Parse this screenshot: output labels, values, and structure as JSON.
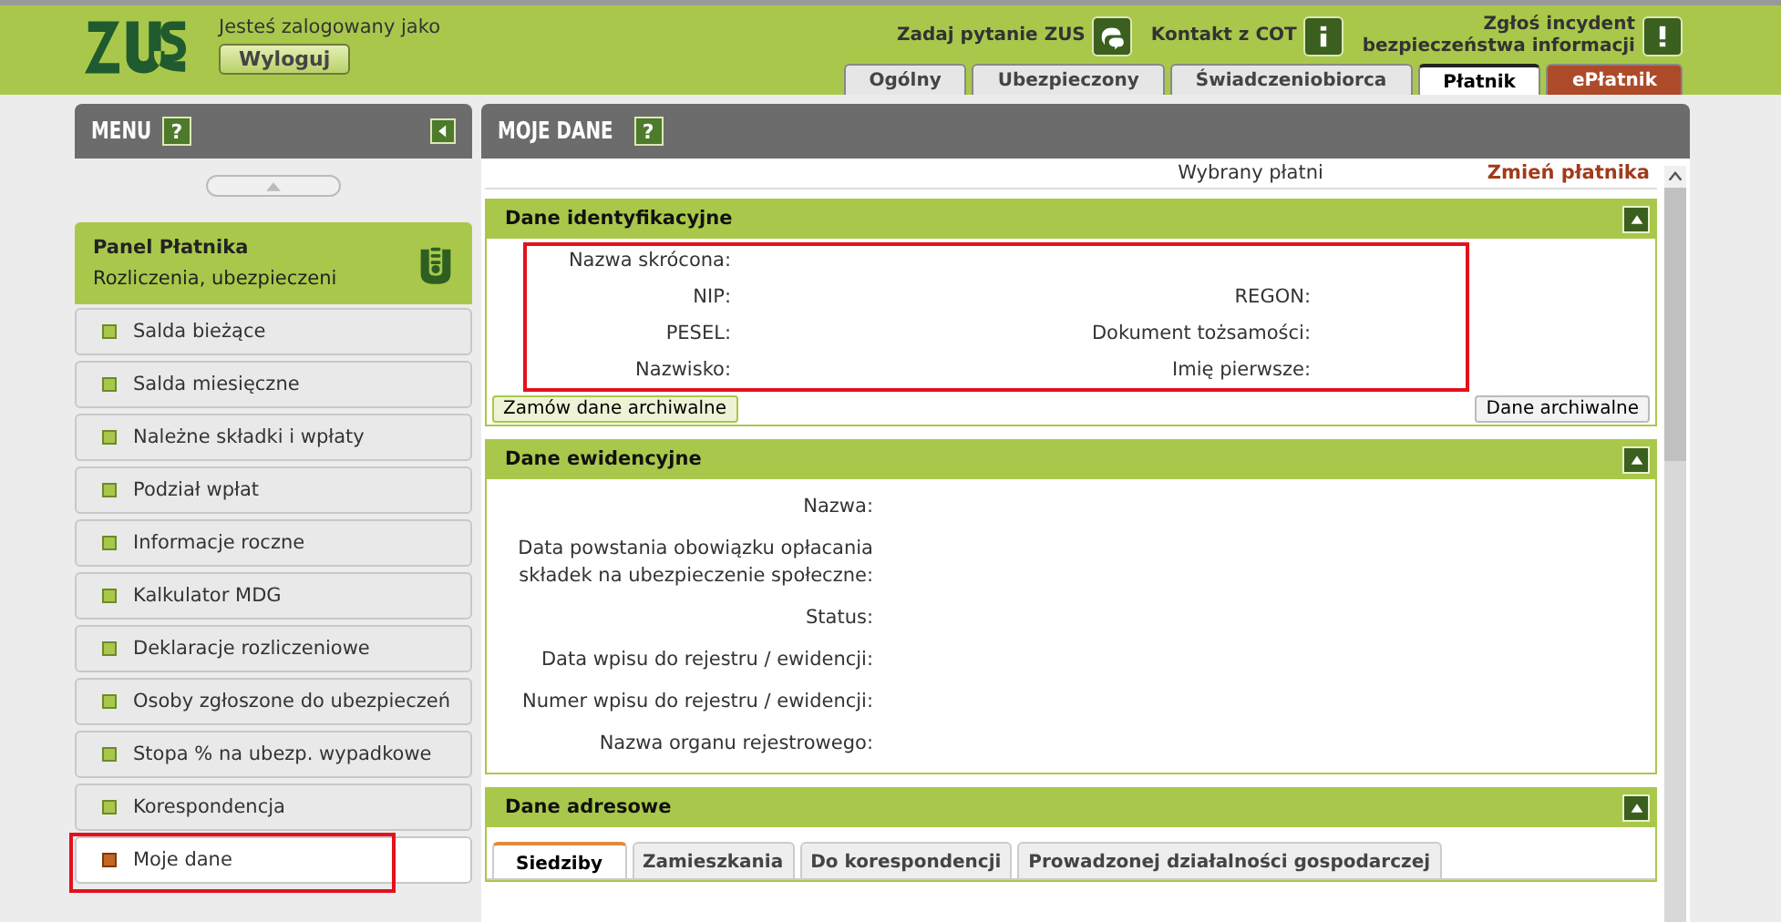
{
  "header": {
    "login_text": "Jesteś zalogowany jako",
    "logout": "Wyloguj",
    "links": [
      {
        "label": "Zadaj pytanie ZUS",
        "kind": "chat"
      },
      {
        "label": "Kontakt z COT",
        "kind": "info"
      },
      {
        "label": "Zgłoś incydent\nbezpieczeństwa informacji",
        "kind": "alert"
      }
    ],
    "tabs": [
      {
        "label": "Ogólny",
        "selected": false,
        "kind": "normal"
      },
      {
        "label": "Ubezpieczony",
        "selected": false,
        "kind": "normal"
      },
      {
        "label": "Świadczeniobiorca",
        "selected": false,
        "kind": "normal"
      },
      {
        "label": "Płatnik",
        "selected": true,
        "kind": "normal"
      },
      {
        "label": "ePłatnik",
        "selected": false,
        "kind": "accent"
      }
    ]
  },
  "sidebar": {
    "title": "MENU",
    "help": "?",
    "panel_title": "Panel Płatnika",
    "panel_subtitle": "Rozliczenia, ubezpieczeni",
    "items": [
      {
        "label": "Salda bieżące",
        "selected": false
      },
      {
        "label": "Salda miesięczne",
        "selected": false
      },
      {
        "label": "Należne składki i wpłaty",
        "selected": false
      },
      {
        "label": "Podział wpłat",
        "selected": false
      },
      {
        "label": "Informacje roczne",
        "selected": false
      },
      {
        "label": "Kalkulator MDG",
        "selected": false
      },
      {
        "label": "Deklaracje rozliczeniowe",
        "selected": false
      },
      {
        "label": "Osoby zgłoszone do ubezpieczeń",
        "selected": false
      },
      {
        "label": "Stopa % na ubezp. wypadkowe",
        "selected": false
      },
      {
        "label": "Korespondencja",
        "selected": false
      },
      {
        "label": "Moje dane",
        "selected": true
      }
    ]
  },
  "main": {
    "title": "MOJE DANE",
    "help": "?",
    "payer_label": "Wybrany płatni",
    "change_payer": "Zmień płatnika",
    "sections": [
      {
        "title": "Dane identyfikacyjne",
        "kind": "grid",
        "fields": [
          [
            "Nazwa skrócona:"
          ],
          [
            "NIP:",
            "REGON:"
          ],
          [
            "PESEL:",
            "Dokument tożsamości:"
          ],
          [
            "Nazwisko:",
            "Imię pierwsze:"
          ]
        ],
        "buttons": [
          "Zamów dane archiwalne",
          "Dane archiwalne"
        ]
      },
      {
        "title": "Dane ewidencyjne",
        "kind": "list",
        "fields": [
          "Nazwa:",
          "Data powstania obowiązku opłacania\nskładek na ubezpieczenie społeczne:",
          "Status:",
          "Data wpisu do rejestru / ewidencji:",
          "Numer wpisu do rejestru / ewidencji:",
          "Nazwa organu rejestrowego:"
        ]
      },
      {
        "title": "Dane adresowe",
        "kind": "tabs",
        "tabs": [
          {
            "label": "Siedziby",
            "selected": true
          },
          {
            "label": "Zamieszkania",
            "selected": false
          },
          {
            "label": "Do korespondencji",
            "selected": false
          },
          {
            "label": "Prowadzonej działalności gospodarczej",
            "selected": false
          }
        ]
      }
    ]
  }
}
